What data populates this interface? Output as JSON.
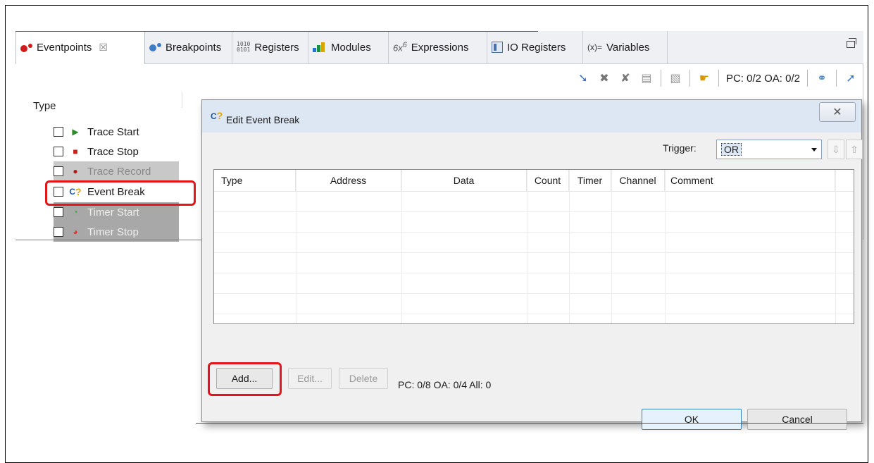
{
  "tabs": [
    {
      "label": "Eventpoints",
      "icon": "eventpoints-icon",
      "active": true,
      "close": "☒"
    },
    {
      "label": "Breakpoints",
      "icon": "breakpoints-icon"
    },
    {
      "label": "Registers",
      "icon": "registers-icon"
    },
    {
      "label": "Modules",
      "icon": "modules-icon"
    },
    {
      "label": "Expressions",
      "icon": "expressions-icon"
    },
    {
      "label": "IO Registers",
      "icon": "io-registers-icon"
    },
    {
      "label": "Variables",
      "icon": "variables-icon",
      "prefix": "(x)="
    }
  ],
  "toolbar": {
    "status": "PC: 0/2 OA: 0/2"
  },
  "tree": {
    "header": "Type",
    "items": [
      {
        "label": "Trace Start",
        "icon": "trace-start-icon",
        "state": "normal"
      },
      {
        "label": "Trace Stop",
        "icon": "trace-stop-icon",
        "state": "normal"
      },
      {
        "label": "Trace Record",
        "icon": "trace-record-icon",
        "state": "dim"
      },
      {
        "label": "Event Break",
        "icon": "event-break-icon",
        "state": "selected"
      },
      {
        "label": "Timer Start",
        "icon": "timer-start-icon",
        "state": "dim2"
      },
      {
        "label": "Timer Stop",
        "icon": "timer-stop-icon",
        "state": "dim2"
      }
    ]
  },
  "dialog": {
    "title": "Edit Event Break",
    "close_symbol": "✕",
    "trigger_label": "Trigger:",
    "trigger_value": "OR",
    "columns": [
      "Type",
      "Address",
      "Data",
      "Count",
      "Timer",
      "Channel",
      "Comment"
    ],
    "buttons": {
      "add": "Add...",
      "edit": "Edit...",
      "delete": "Delete",
      "ok": "OK",
      "cancel": "Cancel"
    },
    "status": "PC: 0/8 OA: 0/4 All: 0"
  },
  "colors": {
    "highlight": "#e3151a",
    "accent": "#3c7fb1"
  }
}
